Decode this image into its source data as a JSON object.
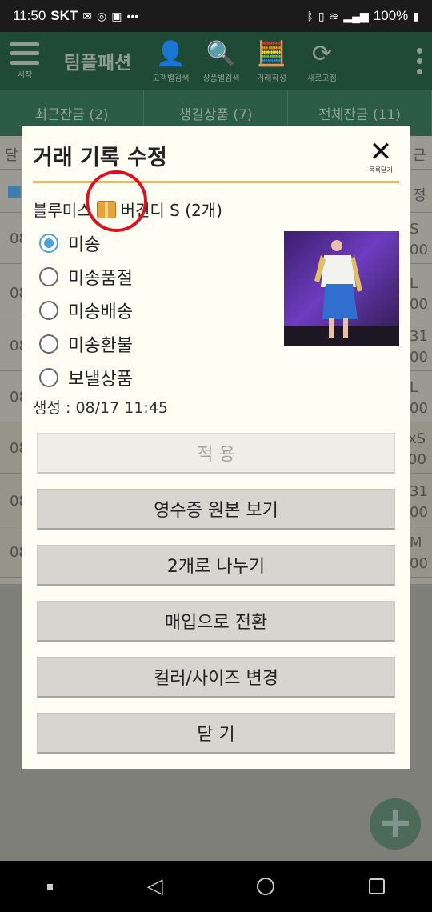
{
  "status_bar": {
    "time": "11:50",
    "carrier": "SKT",
    "battery": "100%"
  },
  "app_bar": {
    "menu_label": "시작",
    "brand": "팀플패션",
    "tools": [
      {
        "name": "customer-search",
        "label": "고객별검색",
        "glyph": "👤"
      },
      {
        "name": "product-search",
        "label": "상품별검색",
        "glyph": "🔍"
      },
      {
        "name": "create-transaction",
        "label": "거래작성",
        "glyph": "🧮"
      },
      {
        "name": "refresh",
        "label": "새로고침",
        "glyph": "⟳"
      }
    ]
  },
  "tabs": [
    "최근잔금 (2)",
    "챙길상품 (7)",
    "전체잔금 (11)"
  ],
  "background_rows": [
    {
      "left": "달",
      "right": "근"
    },
    {
      "left": "",
      "right": "정"
    },
    {
      "left": "08",
      "right": "S\n00"
    },
    {
      "left": "08",
      "right": "L\n00"
    },
    {
      "left": "08",
      "right": "31\n00"
    },
    {
      "left": "08",
      "right": "L\n00"
    },
    {
      "left": "08",
      "right": "xS\n00"
    },
    {
      "left": "08",
      "right": "31\n00"
    },
    {
      "left": "08",
      "right": "M\n00"
    }
  ],
  "dialog": {
    "title": "거래 기록 수정",
    "close_label": "목록닫기",
    "product_prefix": "블루미스",
    "product_suffix": "버건디 S (2개)",
    "options": [
      {
        "label": "미송",
        "selected": true
      },
      {
        "label": "미송품절",
        "selected": false
      },
      {
        "label": "미송배송",
        "selected": false
      },
      {
        "label": "미송환불",
        "selected": false
      },
      {
        "label": "보낼상품",
        "selected": false
      }
    ],
    "created": "생성 : 08/17 11:45",
    "buttons": [
      {
        "label": "적 용",
        "enabled": false
      },
      {
        "label": "영수증 원본 보기",
        "enabled": true
      },
      {
        "label": "2개로 나누기",
        "enabled": true
      },
      {
        "label": "매입으로 전환",
        "enabled": true
      },
      {
        "label": "컬러/사이즈 변경",
        "enabled": true
      },
      {
        "label": "닫 기",
        "enabled": true
      }
    ]
  },
  "colors": {
    "appbar": "#1f4a35",
    "accent": "#4aa3d8",
    "annotation": "#e0101e",
    "divider": "#e3b77a"
  }
}
